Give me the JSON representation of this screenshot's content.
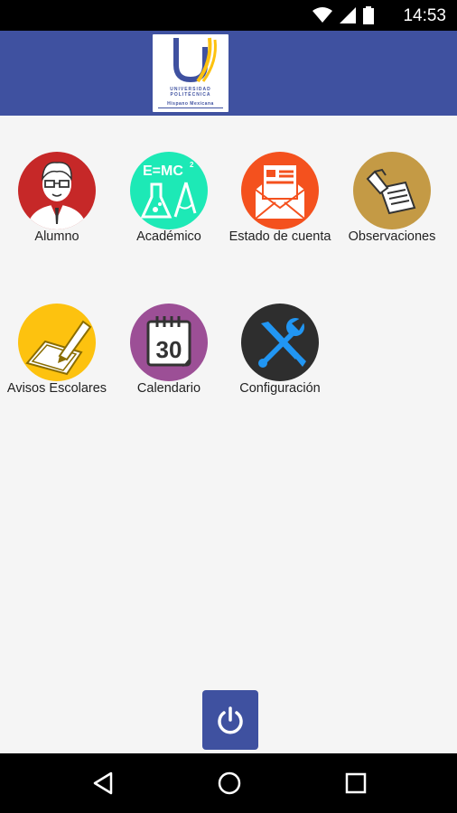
{
  "status_bar": {
    "time": "14:53",
    "icons": [
      "wifi-icon",
      "signal-icon",
      "battery-icon"
    ]
  },
  "header": {
    "logo": {
      "line1": "UNIVERSIDAD",
      "line2": "POLITÉCNICA",
      "line3": "Hispano Mexicana"
    },
    "background": "#3f51a0"
  },
  "menu": {
    "items": [
      {
        "label": "Alumno",
        "icon": "student-icon",
        "color": "#c62828"
      },
      {
        "label": "Académico",
        "icon": "science-icon",
        "color": "#1de9b6"
      },
      {
        "label": "Estado de cuenta",
        "icon": "mail-statement-icon",
        "color": "#f4511e"
      },
      {
        "label": "Observaciones",
        "icon": "notes-icon",
        "color": "#c49a45"
      },
      {
        "label": "Avisos Escolares",
        "icon": "notice-pencil-icon",
        "color": "#fdc20f"
      },
      {
        "label": "Calendario",
        "icon": "calendar-icon",
        "color": "#9c4f96",
        "day": "30"
      },
      {
        "label": "Configuración",
        "icon": "tools-icon",
        "color": "#2e2e2e"
      }
    ]
  },
  "power_button": {
    "icon": "power-icon",
    "color": "#3f51a0"
  },
  "nav_bar": {
    "buttons": [
      "back-icon",
      "home-icon",
      "recents-icon"
    ]
  }
}
